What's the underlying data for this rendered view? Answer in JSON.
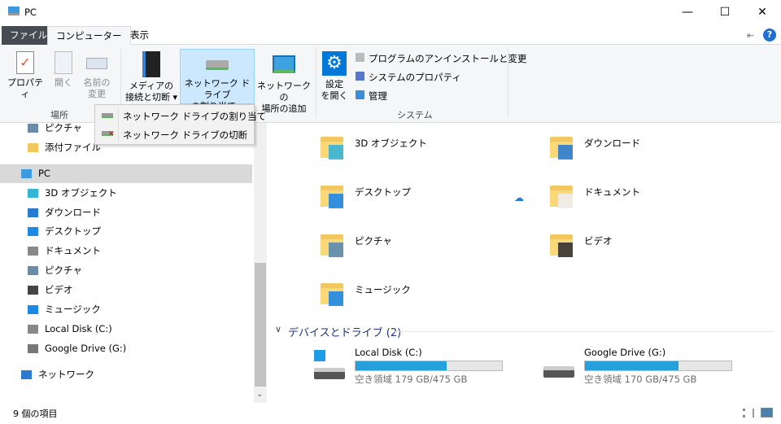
{
  "window": {
    "title": "PC"
  },
  "tabs": {
    "file": "ファイル",
    "computer": "コンピューター",
    "view": "表示"
  },
  "ribbon": {
    "properties": "プロパティ",
    "open": "開く",
    "rename_1": "名前の",
    "rename_2": "変更",
    "group_location": "場所",
    "media_1": "メディアの",
    "media_2": "接続と切断",
    "map_drive_1": "ネットワーク ドライブ",
    "map_drive_2": "の割り当て",
    "add_location_1": "ネットワークの",
    "add_location_2": "場所の追加",
    "settings_1": "設定",
    "settings_2": "を開く",
    "uninstall": "プログラムのアンインストールと変更",
    "system_props": "システムのプロパティ",
    "manage": "管理",
    "group_system": "システム"
  },
  "dropdown": {
    "items": [
      "ネットワーク ドライブの割り当て",
      "ネットワーク ドライブの切断"
    ]
  },
  "nav": {
    "items": [
      "ピクチャ",
      "添付ファイル",
      "PC",
      "3D オブジェクト",
      "ダウンロード",
      "デスクトップ",
      "ドキュメント",
      "ピクチャ",
      "ビデオ",
      "ミュージック",
      "Local Disk (C:)",
      "Google Drive (G:)",
      "ネットワーク"
    ]
  },
  "folders": [
    "3D オブジェクト",
    "ダウンロード",
    "デスクトップ",
    "ドキュメント",
    "ピクチャ",
    "ビデオ",
    "ミュージック"
  ],
  "devices": {
    "header": "デバイスとドライブ (2)",
    "drives": [
      {
        "name": "Local Disk (C:)",
        "free": "空き領域 179 GB/475 GB",
        "used_fraction": 0.62
      },
      {
        "name": "Google Drive (G:)",
        "free": "空き領域 170 GB/475 GB",
        "used_fraction": 0.64
      }
    ]
  },
  "status": {
    "count": "9 個の項目"
  },
  "colors": {
    "accent": "#26a0da",
    "file_tab": "#2b579a",
    "selected": "#cce8ff"
  }
}
